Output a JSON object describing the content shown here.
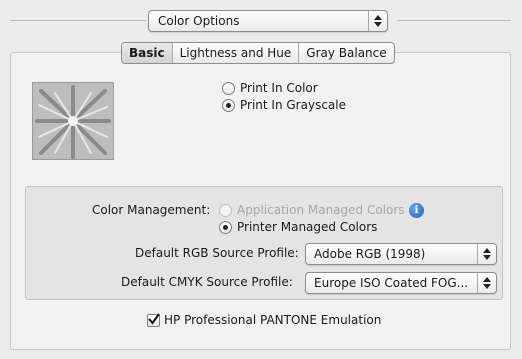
{
  "section_popup": {
    "value": "Color Options"
  },
  "tabs": [
    {
      "label": "Basic",
      "active": true
    },
    {
      "label": "Lightness and Hue",
      "active": false
    },
    {
      "label": "Gray Balance",
      "active": false
    }
  ],
  "print_mode": {
    "options": [
      {
        "label": "Print In Color",
        "selected": false
      },
      {
        "label": "Print In Grayscale",
        "selected": true
      }
    ]
  },
  "color_management": {
    "label": "Color Management:",
    "options": [
      {
        "label": "Application Managed Colors",
        "selected": false,
        "disabled": true
      },
      {
        "label": "Printer Managed Colors",
        "selected": true,
        "disabled": false
      }
    ],
    "info_icon": "info-icon",
    "info_glyph": "i"
  },
  "rgb_profile": {
    "label": "Default RGB Source Profile:",
    "value": "Adobe RGB (1998)"
  },
  "cmyk_profile": {
    "label": "Default CMYK Source Profile:",
    "value": "Europe ISO Coated FOG..."
  },
  "pantone_emulation": {
    "label": "HP Professional PANTONE Emulation",
    "checked": true
  },
  "colors": {
    "background": "#ececec",
    "panel": "#f1f1f1",
    "inner_panel": "#e4e4e4",
    "disabled_text": "#a6a6a6",
    "info_blue": "#1f5fb4"
  }
}
